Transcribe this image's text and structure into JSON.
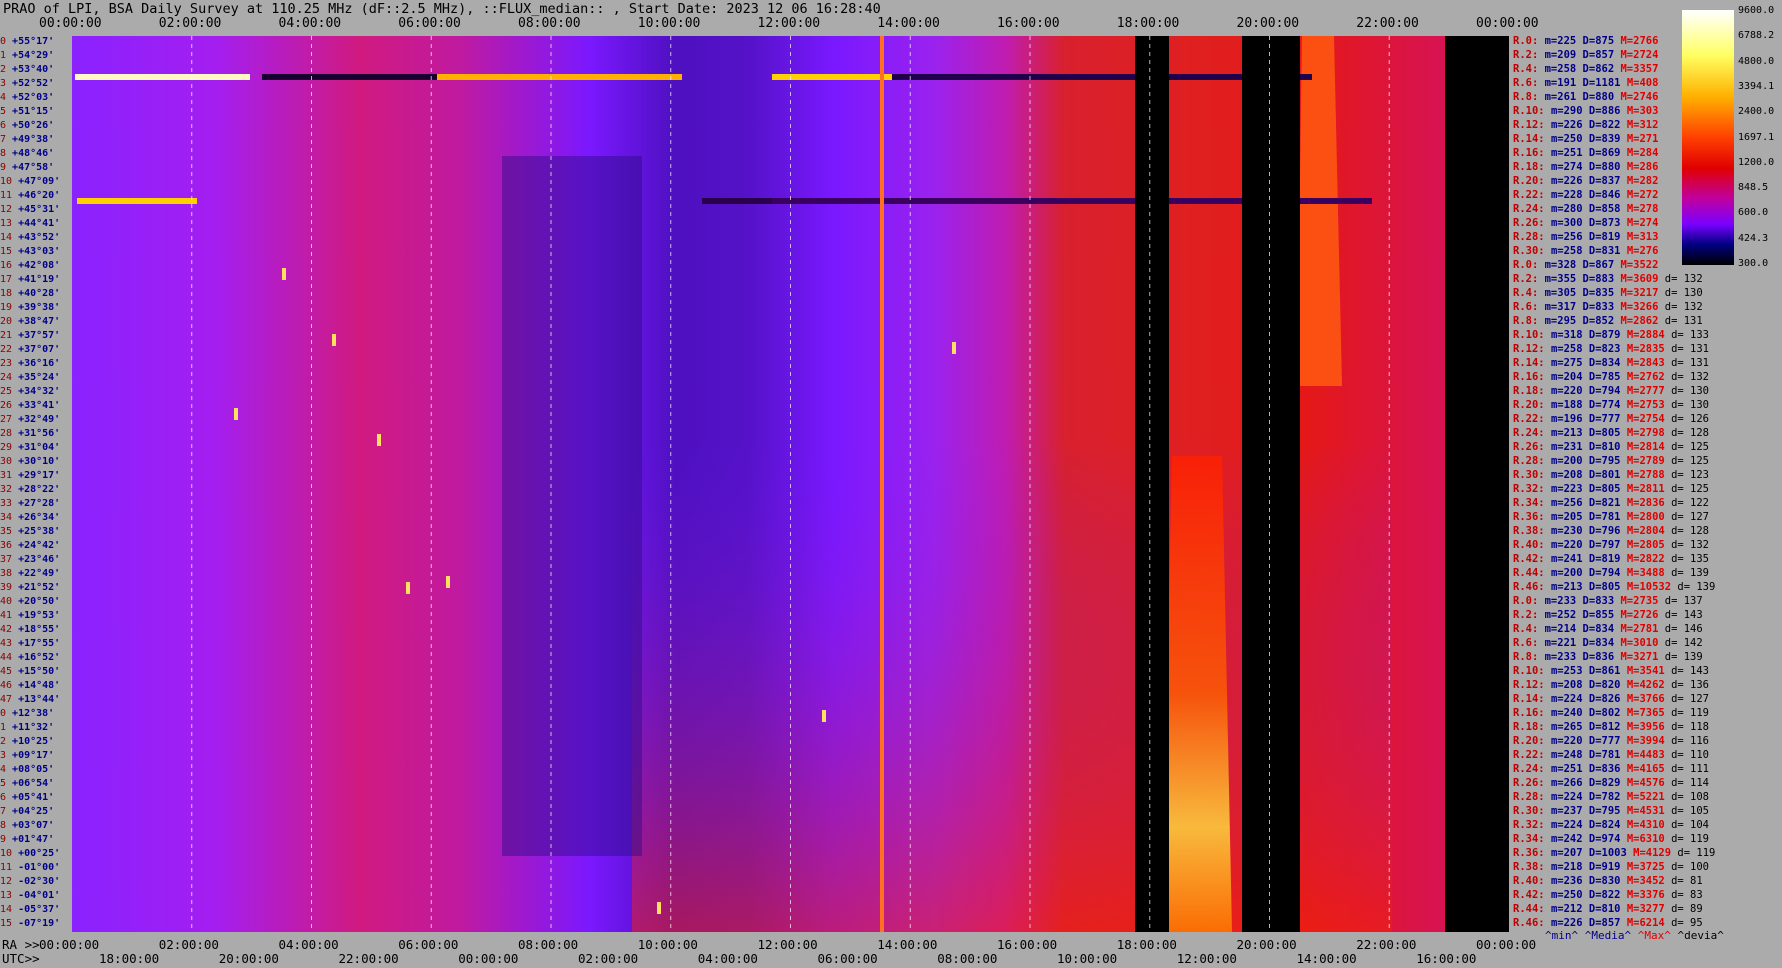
{
  "title": "PRAO of LPI, BSA Daily Survey at 110.25 MHz (dF::2.5 MHz), ::FLUX_median:: , Start Date: 2023 12 06 16:28:40",
  "chart_data": {
    "type": "heatmap",
    "title": "PRAO of LPI, BSA Daily Survey at 110.25 MHz (dF::2.5 MHz), ::FLUX_median:: , Start Date: 2023 12 06 16:28:40",
    "x_top_ticks": [
      "00:00:00",
      "02:00:00",
      "04:00:00",
      "06:00:00",
      "08:00:00",
      "10:00:00",
      "12:00:00",
      "14:00:00",
      "16:00:00",
      "18:00:00",
      "20:00:00",
      "22:00:00",
      "00:00:00"
    ],
    "x_bottom_ra_label": "RA >>",
    "x_bottom_ra_ticks": [
      "00:00:00",
      "02:00:00",
      "04:00:00",
      "06:00:00",
      "08:00:00",
      "10:00:00",
      "12:00:00",
      "14:00:00",
      "16:00:00",
      "18:00:00",
      "20:00:00",
      "22:00:00",
      "00:00:00"
    ],
    "x_bottom_utc_label": "UTC>>",
    "x_bottom_utc_ticks": [
      "18:00:00",
      "20:00:00",
      "22:00:00",
      "00:00:00",
      "02:00:00",
      "04:00:00",
      "06:00:00",
      "08:00:00",
      "10:00:00",
      "12:00:00",
      "14:00:00",
      "16:00:00"
    ],
    "y_declinations": [
      "+55°17'",
      "+54°29'",
      "+53°40'",
      "+52°52'",
      "+52°03'",
      "+51°15'",
      "+50°26'",
      "+49°38'",
      "+48°46'",
      "+47°58'",
      "+47°09'",
      "+46°20'",
      "+45°31'",
      "+44°41'",
      "+43°52'",
      "+43°03'",
      "+42°08'",
      "+41°19'",
      "+40°28'",
      "+39°38'",
      "+38°47'",
      "+37°57'",
      "+37°07'",
      "+36°16'",
      "+35°24'",
      "+34°32'",
      "+33°41'",
      "+32°49'",
      "+31°56'",
      "+31°04'",
      "+30°10'",
      "+29°17'",
      "+28°22'",
      "+27°28'",
      "+26°34'",
      "+25°38'",
      "+24°42'",
      "+23°46'",
      "+22°49'",
      "+21°52'",
      "+20°50'",
      "+19°53'",
      "+18°55'",
      "+17°55'",
      "+16°52'",
      "+15°50'",
      "+14°48'",
      "+13°44'",
      "+12°38'",
      "+11°32'",
      "+10°25'",
      "+09°17'",
      "+08°05'",
      "+06°54'",
      "+05°41'",
      "+04°25'",
      "+03°07'",
      "+01°47'",
      "+00°25'",
      "-01°00'",
      "-02°30'",
      "-04°01'",
      "-05°37'",
      "-07°19'"
    ],
    "colorbar_labels": [
      "9600.0",
      "6788.2",
      "4800.0",
      "3394.1",
      "2400.0",
      "1697.1",
      "1200.0",
      "848.5",
      "600.0",
      "424.3",
      "300.0"
    ],
    "stats_rows": [
      {
        "r": "R.0:",
        "m": "m=225",
        "D": "D=875",
        "M": "M=2766",
        "d": ""
      },
      {
        "r": "R.2:",
        "m": "m=209",
        "D": "D=857",
        "M": "M=2724",
        "d": ""
      },
      {
        "r": "R.4:",
        "m": "m=258",
        "D": "D=862",
        "M": "M=3357",
        "d": ""
      },
      {
        "r": "R.6:",
        "m": "m=191",
        "D": "D=1181",
        "M": "M=408",
        "d": ""
      },
      {
        "r": "R.8:",
        "m": "m=261",
        "D": "D=880",
        "M": "M=2746",
        "d": ""
      },
      {
        "r": "R.10:",
        "m": "m=290",
        "D": "D=886",
        "M": "M=303",
        "d": ""
      },
      {
        "r": "R.12:",
        "m": "m=226",
        "D": "D=822",
        "M": "M=312",
        "d": ""
      },
      {
        "r": "R.14:",
        "m": "m=250",
        "D": "D=839",
        "M": "M=271",
        "d": ""
      },
      {
        "r": "R.16:",
        "m": "m=251",
        "D": "D=869",
        "M": "M=284",
        "d": ""
      },
      {
        "r": "R.18:",
        "m": "m=274",
        "D": "D=880",
        "M": "M=286",
        "d": ""
      },
      {
        "r": "R.20:",
        "m": "m=226",
        "D": "D=837",
        "M": "M=282",
        "d": ""
      },
      {
        "r": "R.22:",
        "m": "m=228",
        "D": "D=846",
        "M": "M=272",
        "d": ""
      },
      {
        "r": "R.24:",
        "m": "m=280",
        "D": "D=858",
        "M": "M=278",
        "d": ""
      },
      {
        "r": "R.26:",
        "m": "m=300",
        "D": "D=873",
        "M": "M=274",
        "d": ""
      },
      {
        "r": "R.28:",
        "m": "m=256",
        "D": "D=819",
        "M": "M=313",
        "d": ""
      },
      {
        "r": "R.30:",
        "m": "m=258",
        "D": "D=831",
        "M": "M=276",
        "d": ""
      },
      {
        "r": "R.0:",
        "m": "m=328",
        "D": "D=867",
        "M": "M=3522",
        "d": ""
      },
      {
        "r": "R.2:",
        "m": "m=355",
        "D": "D=883",
        "M": "M=3609",
        "d": "d= 132"
      },
      {
        "r": "R.4:",
        "m": "m=305",
        "D": "D=835",
        "M": "M=3217",
        "d": "d= 130"
      },
      {
        "r": "R.6:",
        "m": "m=317",
        "D": "D=833",
        "M": "M=3266",
        "d": "d= 132"
      },
      {
        "r": "R.8:",
        "m": "m=295",
        "D": "D=852",
        "M": "M=2862",
        "d": "d= 131"
      },
      {
        "r": "R.10:",
        "m": "m=318",
        "D": "D=879",
        "M": "M=2884",
        "d": "d= 133"
      },
      {
        "r": "R.12:",
        "m": "m=258",
        "D": "D=823",
        "M": "M=2835",
        "d": "d= 131"
      },
      {
        "r": "R.14:",
        "m": "m=275",
        "D": "D=834",
        "M": "M=2843",
        "d": "d= 131"
      },
      {
        "r": "R.16:",
        "m": "m=204",
        "D": "D=785",
        "M": "M=2762",
        "d": "d= 132"
      },
      {
        "r": "R.18:",
        "m": "m=220",
        "D": "D=794",
        "M": "M=2777",
        "d": "d= 130"
      },
      {
        "r": "R.20:",
        "m": "m=188",
        "D": "D=774",
        "M": "M=2753",
        "d": "d= 130"
      },
      {
        "r": "R.22:",
        "m": "m=196",
        "D": "D=777",
        "M": "M=2754",
        "d": "d= 126"
      },
      {
        "r": "R.24:",
        "m": "m=213",
        "D": "D=805",
        "M": "M=2798",
        "d": "d= 128"
      },
      {
        "r": "R.26:",
        "m": "m=231",
        "D": "D=810",
        "M": "M=2814",
        "d": "d= 125"
      },
      {
        "r": "R.28:",
        "m": "m=200",
        "D": "D=795",
        "M": "M=2789",
        "d": "d= 125"
      },
      {
        "r": "R.30:",
        "m": "m=208",
        "D": "D=801",
        "M": "M=2788",
        "d": "d= 123"
      },
      {
        "r": "R.32:",
        "m": "m=223",
        "D": "D=805",
        "M": "M=2811",
        "d": "d= 125"
      },
      {
        "r": "R.34:",
        "m": "m=256",
        "D": "D=821",
        "M": "M=2836",
        "d": "d= 122"
      },
      {
        "r": "R.36:",
        "m": "m=205",
        "D": "D=781",
        "M": "M=2800",
        "d": "d= 127"
      },
      {
        "r": "R.38:",
        "m": "m=230",
        "D": "D=796",
        "M": "M=2804",
        "d": "d= 128"
      },
      {
        "r": "R.40:",
        "m": "m=220",
        "D": "D=797",
        "M": "M=2805",
        "d": "d= 132"
      },
      {
        "r": "R.42:",
        "m": "m=241",
        "D": "D=819",
        "M": "M=2822",
        "d": "d= 135"
      },
      {
        "r": "R.44:",
        "m": "m=200",
        "D": "D=794",
        "M": "M=3488",
        "d": "d= 139"
      },
      {
        "r": "R.46:",
        "m": "m=213",
        "D": "D=805",
        "M": "M=10532",
        "d": "d= 139"
      },
      {
        "r": "R.0:",
        "m": "m=233",
        "D": "D=833",
        "M": "M=2735",
        "d": "d= 137"
      },
      {
        "r": "R.2:",
        "m": "m=252",
        "D": "D=855",
        "M": "M=2726",
        "d": "d= 143"
      },
      {
        "r": "R.4:",
        "m": "m=214",
        "D": "D=834",
        "M": "M=2781",
        "d": "d= 146"
      },
      {
        "r": "R.6:",
        "m": "m=221",
        "D": "D=834",
        "M": "M=3010",
        "d": "d= 142"
      },
      {
        "r": "R.8:",
        "m": "m=233",
        "D": "D=836",
        "M": "M=3271",
        "d": "d= 139"
      },
      {
        "r": "R.10:",
        "m": "m=253",
        "D": "D=861",
        "M": "M=3541",
        "d": "d= 143"
      },
      {
        "r": "R.12:",
        "m": "m=208",
        "D": "D=820",
        "M": "M=4262",
        "d": "d= 136"
      },
      {
        "r": "R.14:",
        "m": "m=224",
        "D": "D=826",
        "M": "M=3766",
        "d": "d= 127"
      },
      {
        "r": "R.16:",
        "m": "m=240",
        "D": "D=802",
        "M": "M=7365",
        "d": "d= 119"
      },
      {
        "r": "R.18:",
        "m": "m=265",
        "D": "D=812",
        "M": "M=3956",
        "d": "d= 118"
      },
      {
        "r": "R.20:",
        "m": "m=220",
        "D": "D=777",
        "M": "M=3994",
        "d": "d= 116"
      },
      {
        "r": "R.22:",
        "m": "m=248",
        "D": "D=781",
        "M": "M=4483",
        "d": "d= 110"
      },
      {
        "r": "R.24:",
        "m": "m=251",
        "D": "D=836",
        "M": "M=4165",
        "d": "d= 111"
      },
      {
        "r": "R.26:",
        "m": "m=266",
        "D": "D=829",
        "M": "M=4576",
        "d": "d= 114"
      },
      {
        "r": "R.28:",
        "m": "m=224",
        "D": "D=782",
        "M": "M=5221",
        "d": "d= 108"
      },
      {
        "r": "R.30:",
        "m": "m=237",
        "D": "D=795",
        "M": "M=4531",
        "d": "d= 105"
      },
      {
        "r": "R.32:",
        "m": "m=224",
        "D": "D=824",
        "M": "M=4310",
        "d": "d= 104"
      },
      {
        "r": "R.34:",
        "m": "m=242",
        "D": "D=974",
        "M": "M=6310",
        "d": "d= 119"
      },
      {
        "r": "R.36:",
        "m": "m=207",
        "D": "D=1003",
        "M": "M=4129",
        "d": "d= 119"
      },
      {
        "r": "R.38:",
        "m": "m=218",
        "D": "D=919",
        "M": "M=3725",
        "d": "d= 100"
      },
      {
        "r": "R.40:",
        "m": "m=236",
        "D": "D=830",
        "M": "M=3452",
        "d": "d= 81"
      },
      {
        "r": "R.42:",
        "m": "m=250",
        "D": "D=822",
        "M": "M=3376",
        "d": "d= 83"
      },
      {
        "r": "R.44:",
        "m": "m=212",
        "D": "D=810",
        "M": "M=3277",
        "d": "d= 89"
      },
      {
        "r": "R.46:",
        "m": "m=226",
        "D": "D=857",
        "M": "M=6214",
        "d": "d= 95"
      }
    ],
    "stats_legend": {
      "min": "^min^",
      "median": "^Media^",
      "max": "^Max^",
      "dev": "^devia^"
    }
  }
}
